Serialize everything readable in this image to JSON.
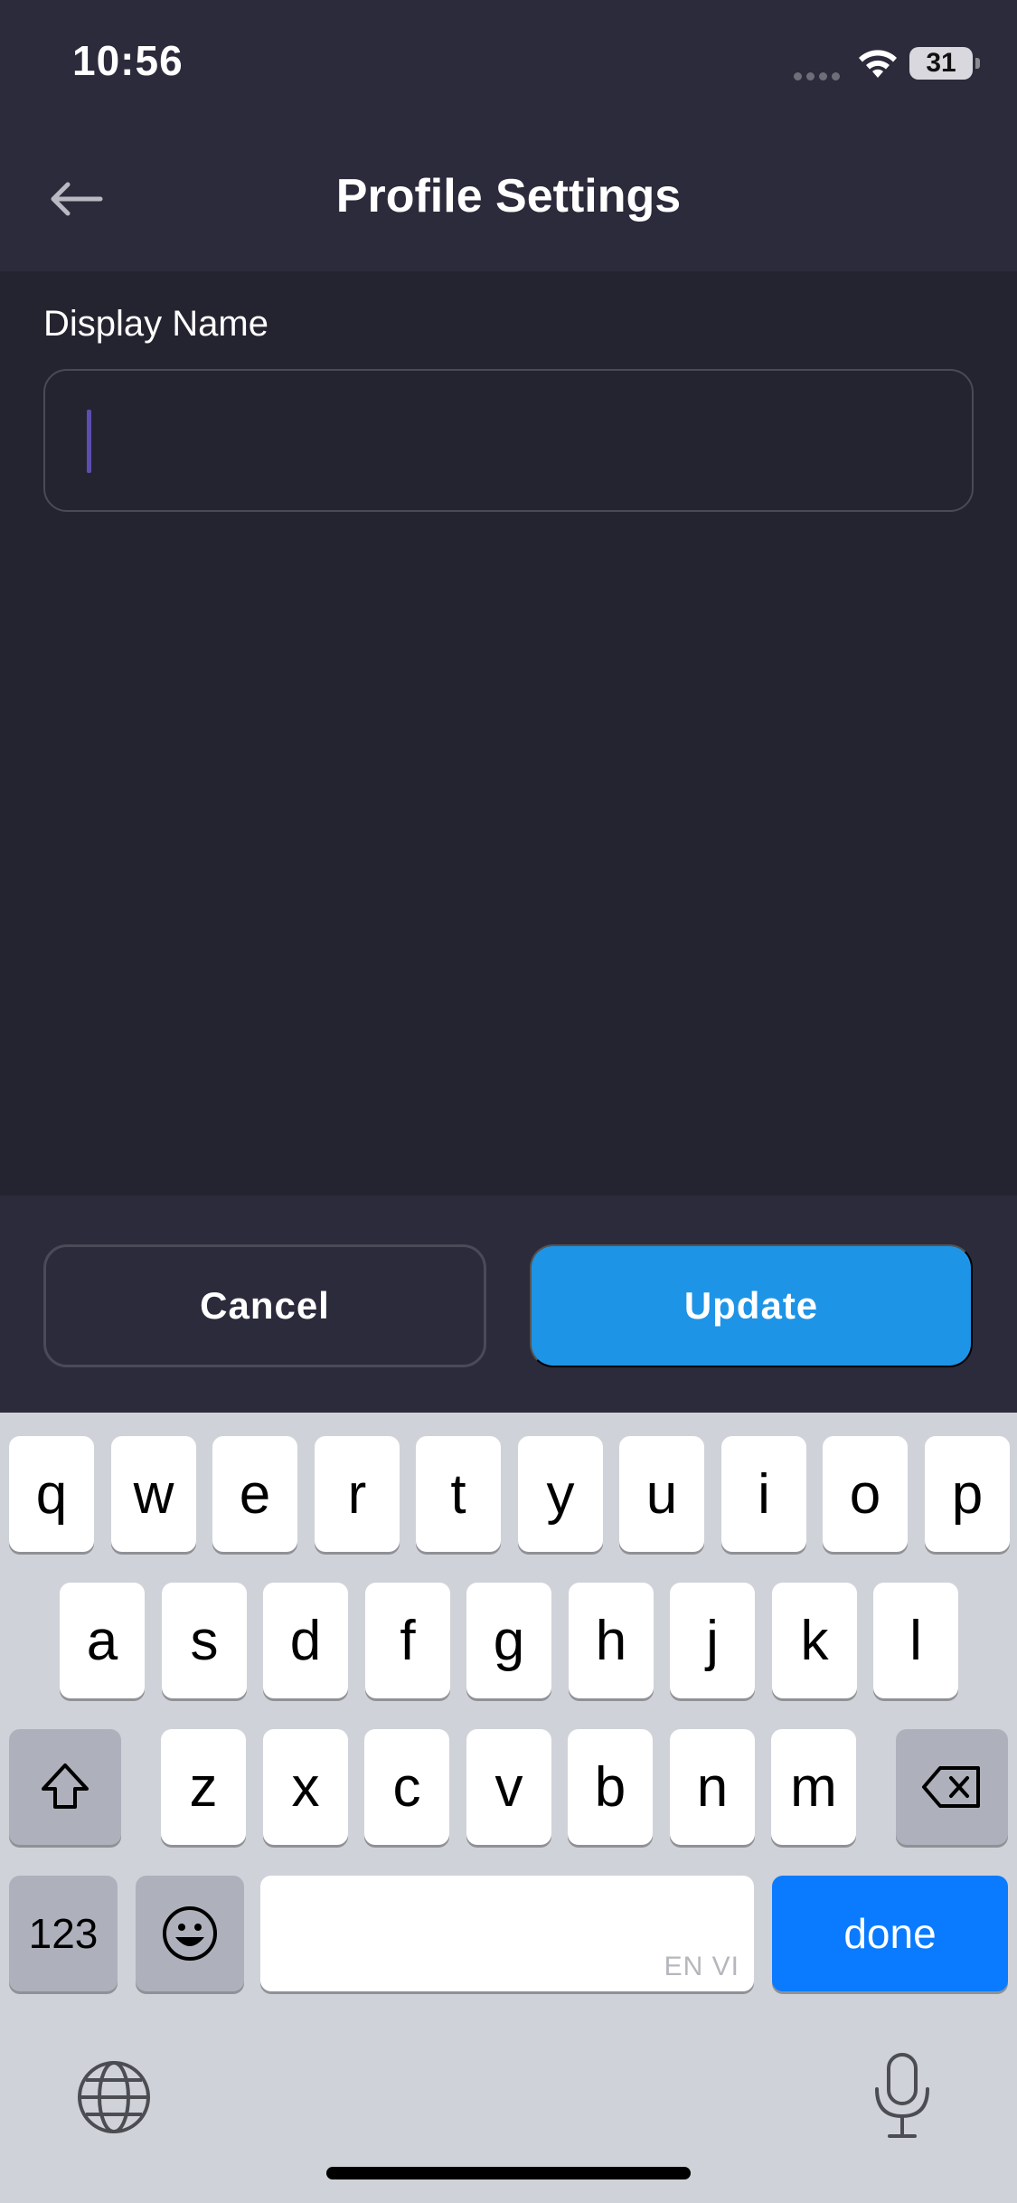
{
  "status_bar": {
    "time": "10:56",
    "battery": "31"
  },
  "header": {
    "title": "Profile Settings"
  },
  "form": {
    "display_name_label": "Display Name",
    "display_name_value": "",
    "display_name_placeholder": ""
  },
  "actions": {
    "cancel_label": "Cancel",
    "update_label": "Update"
  },
  "keyboard": {
    "row1": [
      "q",
      "w",
      "e",
      "r",
      "t",
      "y",
      "u",
      "i",
      "o",
      "p"
    ],
    "row2": [
      "a",
      "s",
      "d",
      "f",
      "g",
      "h",
      "j",
      "k",
      "l"
    ],
    "row3": [
      "z",
      "x",
      "c",
      "v",
      "b",
      "n",
      "m"
    ],
    "numbers_label": "123",
    "done_label": "done",
    "language_label": "EN VI"
  },
  "icons": {
    "back": "arrow-left-icon",
    "shift": "shift-icon",
    "delete": "backspace-icon",
    "emoji": "emoji-icon",
    "globe": "globe-icon",
    "mic": "microphone-icon",
    "wifi": "wifi-icon"
  },
  "colors": {
    "header_bg": "#2b2b3b",
    "body_bg": "#242430",
    "update_button": "#1e94e6",
    "done_key": "#0a7bff",
    "caret": "#5a4fb0"
  }
}
